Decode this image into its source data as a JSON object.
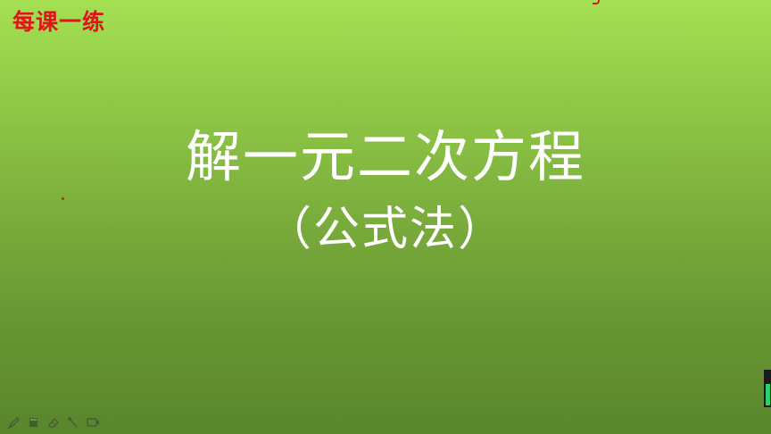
{
  "slide": {
    "corner_label": "每课一练",
    "title": "解一元二次方程",
    "subtitle": "（公式法）"
  },
  "toolbar": {
    "tools": [
      "pen-icon",
      "highlighter-icon",
      "eraser-icon",
      "laser-pointer-icon",
      "screen-icon"
    ]
  },
  "colors": {
    "background_top": "#a4e052",
    "background_bottom": "#5a862c",
    "corner_label": "#e0141a",
    "title_text": "#ffffff"
  }
}
